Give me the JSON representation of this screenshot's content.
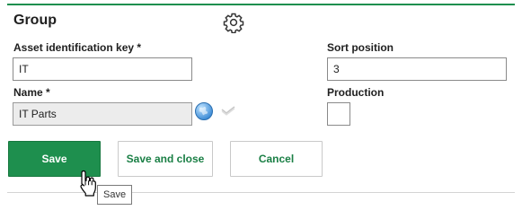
{
  "form": {
    "title": "Group",
    "asset_key": {
      "label": "Asset identification key *",
      "value": "IT"
    },
    "name": {
      "label": "Name *",
      "value": "IT Parts"
    },
    "sort_position": {
      "label": "Sort position",
      "value": "3"
    },
    "production": {
      "label": "Production",
      "checked": false
    }
  },
  "buttons": {
    "save": "Save",
    "save_close": "Save and close",
    "cancel": "Cancel"
  },
  "tooltip": {
    "text": "Save"
  },
  "icons": {
    "settings": "gear-icon",
    "translate": "globe-icon",
    "confirm": "check-icon",
    "pointer": "hand-cursor-icon"
  },
  "colors": {
    "accent": "#1e8f4e",
    "accent_text": "#1a7f45",
    "readonly_bg": "#ececec"
  }
}
